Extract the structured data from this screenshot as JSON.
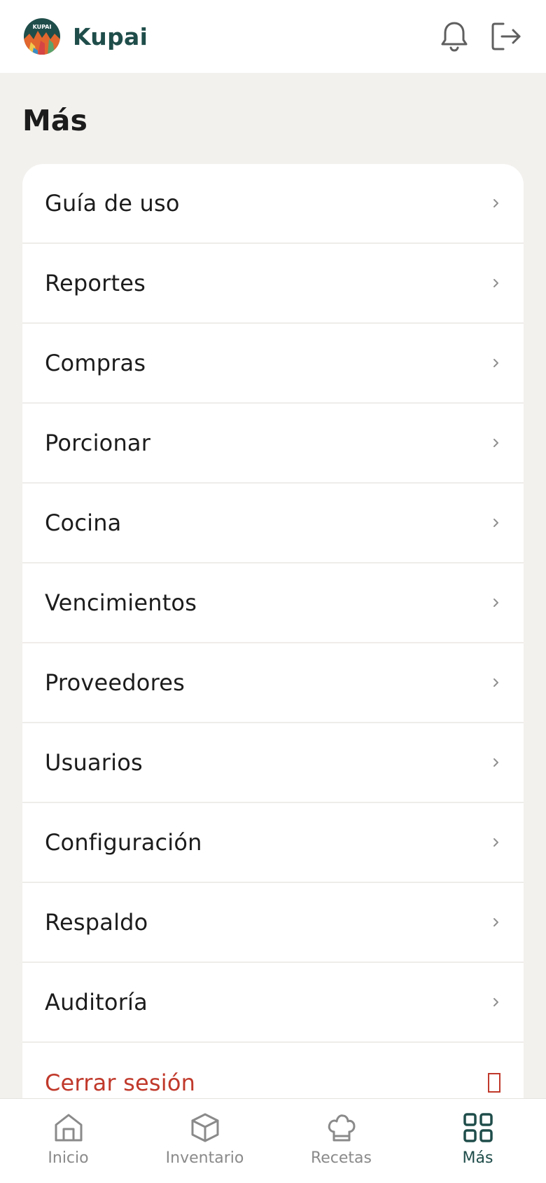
{
  "app": {
    "name": "Kupai",
    "logo_text": "KUPAI"
  },
  "header": {
    "notifications_icon": "bell-icon",
    "logout_icon": "logout-icon"
  },
  "page": {
    "title": "Más"
  },
  "menu": {
    "items": [
      {
        "id": "guia-de-uso",
        "label": "Guía de uso"
      },
      {
        "id": "reportes",
        "label": "Reportes"
      },
      {
        "id": "compras",
        "label": "Compras"
      },
      {
        "id": "porcionar",
        "label": "Porcionar"
      },
      {
        "id": "cocina",
        "label": "Cocina"
      },
      {
        "id": "vencimientos",
        "label": "Vencimientos"
      },
      {
        "id": "proveedores",
        "label": "Proveedores"
      },
      {
        "id": "usuarios",
        "label": "Usuarios"
      },
      {
        "id": "configuracion",
        "label": "Configuración"
      },
      {
        "id": "respaldo",
        "label": "Respaldo"
      },
      {
        "id": "auditoria",
        "label": "Auditoría"
      }
    ],
    "logout": {
      "label": "Cerrar sesión",
      "color": "#c0392b"
    }
  },
  "bottom_nav": {
    "items": [
      {
        "id": "inicio",
        "label": "Inicio",
        "icon": "home-icon",
        "active": false
      },
      {
        "id": "inventario",
        "label": "Inventario",
        "icon": "box-icon",
        "active": false
      },
      {
        "id": "recetas",
        "label": "Recetas",
        "icon": "chef-hat-icon",
        "active": false
      },
      {
        "id": "mas",
        "label": "Más",
        "icon": "grid-icon",
        "active": true
      }
    ]
  },
  "colors": {
    "brand": "#1f4d4a",
    "background": "#f3f1ee",
    "danger": "#c0392b",
    "inactive": "#8a8a8a"
  }
}
